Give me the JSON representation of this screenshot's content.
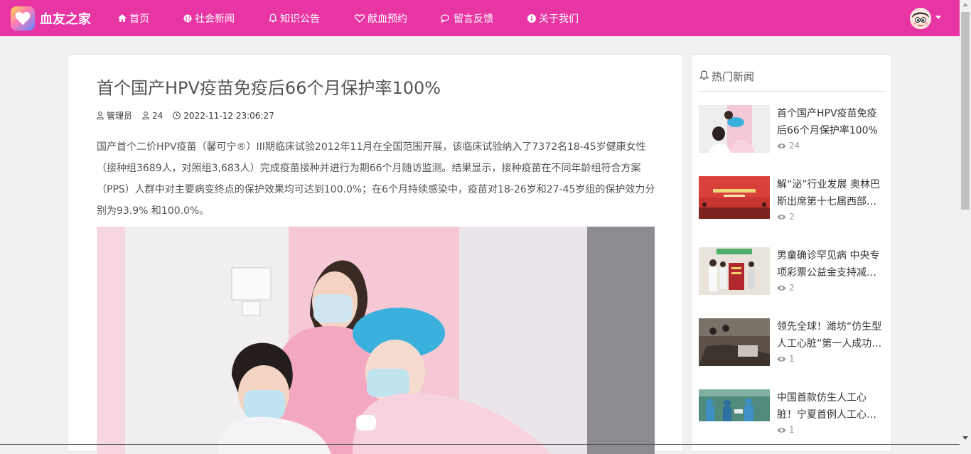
{
  "brand": {
    "name": "血友之家"
  },
  "nav": [
    {
      "label": "首页",
      "icon": "home-icon"
    },
    {
      "label": "社会新闻",
      "icon": "globe-icon"
    },
    {
      "label": "知识公告",
      "icon": "bell-icon"
    },
    {
      "label": "献血预约",
      "icon": "heart-icon"
    },
    {
      "label": "留言反馈",
      "icon": "comments-icon"
    },
    {
      "label": "关于我们",
      "icon": "info-circle-icon"
    }
  ],
  "user": {
    "avatar": "avatar-icon"
  },
  "article": {
    "title": "首个国产HPV疫苗免疫后66个月保护率100%",
    "author": "管理员",
    "views": "24",
    "date": "2022-11-12 23:06:27",
    "content": "国产首个二价HPV疫苗（馨可宁®）III期临床试验2012年11月在全国范围开展，该临床试验纳入了7372名18-45岁健康女性（接种组3689人，对照组3,683人）完成疫苗接种并进行为期66个月随访监测。结果显示，接种疫苗在不同年龄组符合方案（PPS）人群中对主要病变终点的保护效果均可达到100.0%；在6个月持续感染中，疫苗对18-26岁和27-45岁组的保护效力分别为93.9% 和100.0%。"
  },
  "sidebar": {
    "heading": "热门新闻",
    "items": [
      {
        "title": "首个国产HPV疫苗免疫后66个月保护率100%",
        "views": "24"
      },
      {
        "title": "解“泌”行业发展 奥林巴斯出席第十七届西部医疗器械展",
        "views": "2"
      },
      {
        "title": "男童确诊罕见病 中央专项彩票公益金支持减免治疗费用",
        "views": "2"
      },
      {
        "title": "领先全球！潍坊“仿生型人工心脏”第一人成功出院",
        "views": "1"
      },
      {
        "title": "中国首款仿生人工心脏！宁夏首例人工心脏植入手术成功",
        "views": "1"
      }
    ]
  },
  "colors": {
    "accent": "#e835a4",
    "background": "#f1f1f1"
  }
}
